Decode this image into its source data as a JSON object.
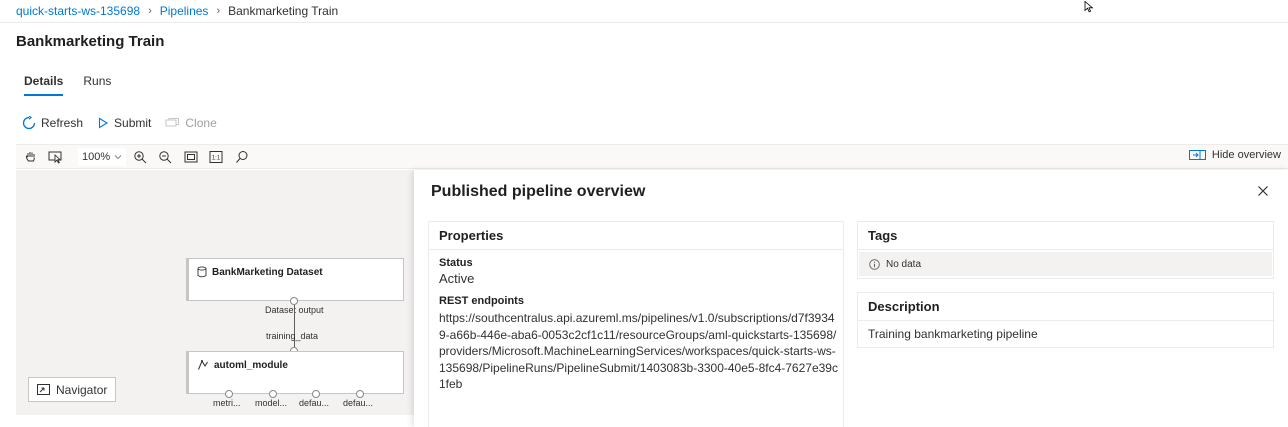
{
  "breadcrumb": {
    "workspace": "quick-starts-ws-135698",
    "pipelines": "Pipelines",
    "current": "Bankmarketing Train"
  },
  "page": {
    "title": "Bankmarketing Train"
  },
  "tabs": [
    {
      "label": "Details",
      "active": true
    },
    {
      "label": "Runs",
      "active": false
    }
  ],
  "commands": {
    "refresh": "Refresh",
    "submit": "Submit",
    "clone": "Clone"
  },
  "canvas_toolbar": {
    "zoom": "100%",
    "hide_overview": "Hide overview"
  },
  "graph": {
    "dataset_node": {
      "label": "BankMarketing Dataset",
      "output_label": "Dataset output"
    },
    "edge_label": "training_data",
    "automl_node": {
      "label": "automl_module",
      "outputs": [
        "metri...",
        "model...",
        "defau...",
        "defau..."
      ]
    },
    "navigator": "Navigator"
  },
  "overview": {
    "title": "Published pipeline overview",
    "properties": {
      "header": "Properties",
      "status_label": "Status",
      "status_value": "Active",
      "rest_label": "REST endpoints",
      "rest_value": "https://southcentralus.api.azureml.ms/pipelines/v1.0/subscriptions/d7f39349-a66b-446e-aba6-0053c2cf1c11/resourceGroups/aml-quickstarts-135698/providers/Microsoft.MachineLearningServices/workspaces/quick-starts-ws-135698/PipelineRuns/PipelineSubmit/1403083b-3300-40e5-8fc4-7627e39c1feb"
    },
    "tags": {
      "header": "Tags",
      "empty": "No data"
    },
    "description": {
      "header": "Description",
      "text": "Training bankmarketing pipeline"
    }
  },
  "colors": {
    "accent": "#0078d4",
    "canvas_bg": "#f3f2f1",
    "text": "#201f1e"
  }
}
